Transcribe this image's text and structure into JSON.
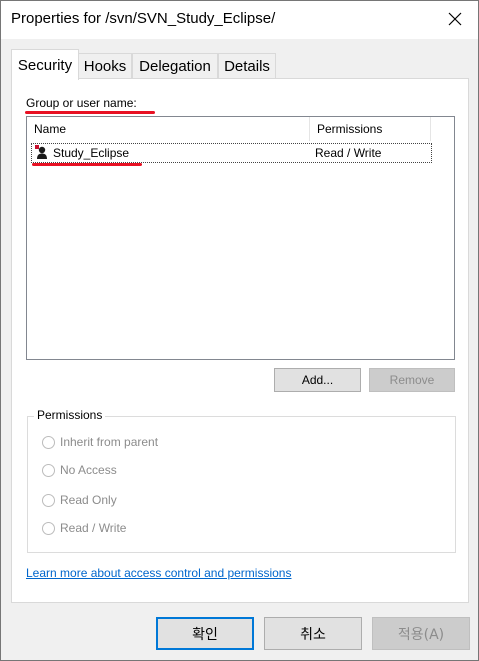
{
  "window": {
    "title": "Properties for /svn/SVN_Study_Eclipse/"
  },
  "tabs": [
    {
      "label": "Security",
      "active": true
    },
    {
      "label": "Hooks",
      "active": false
    },
    {
      "label": "Delegation",
      "active": false
    },
    {
      "label": "Details",
      "active": false
    }
  ],
  "security": {
    "group_label": "Group or user name:",
    "columns": [
      "Name",
      "Permissions"
    ],
    "rows": [
      {
        "name": "Study_Eclipse",
        "permissions": "Read / Write",
        "icon": "group-icon"
      }
    ],
    "add_button": "Add...",
    "remove_button": "Remove",
    "permissions_legend": "Permissions",
    "options": [
      {
        "label": "Inherit from parent"
      },
      {
        "label": "No Access"
      },
      {
        "label": "Read Only"
      },
      {
        "label": "Read / Write"
      }
    ],
    "learn_more_link": "Learn more about access control and permissions"
  },
  "footer": {
    "ok": "확인",
    "cancel": "취소",
    "apply": "적용(A)"
  },
  "colors": {
    "accent": "#0078d7",
    "annotation": "#e81123",
    "link": "#0066cc"
  }
}
